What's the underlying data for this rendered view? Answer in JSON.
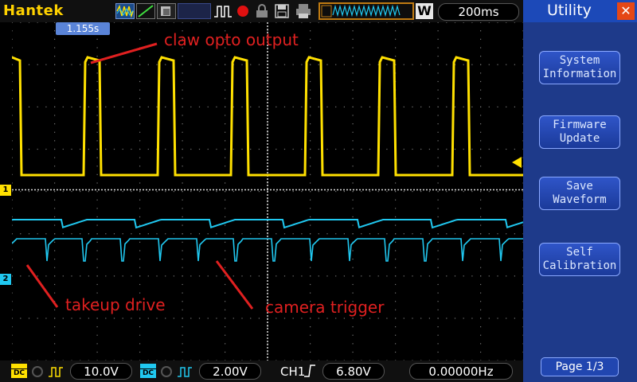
{
  "header": {
    "brand": "Hantek",
    "timebase": "200ms",
    "w_label": "W"
  },
  "cursor_readout": "1.155s",
  "annotations": {
    "claw": "claw opto output",
    "takeup": "takeup drive",
    "camera": "camera trigger"
  },
  "channel_markers": {
    "ch1": "1",
    "ch2": "2"
  },
  "sidebar": {
    "title": "Utility",
    "buttons": [
      {
        "line1": "System",
        "line2": "Information"
      },
      {
        "line1": "Firmware",
        "line2": "Update"
      },
      {
        "line1": "Save",
        "line2": "Waveform"
      },
      {
        "line1": "Self",
        "line2": "Calibration"
      }
    ],
    "page": "Page 1/3"
  },
  "bottom": {
    "ch1_scale": "10.0V",
    "ch2_scale": "2.00V",
    "trigger_source": "CH1",
    "trigger_level": "6.80V",
    "frequency": "0.00000Hz",
    "coupling_dc": "DC"
  },
  "colors": {
    "ch1": "#ffe000",
    "ch2": "#20c8f0",
    "annotation": "#e02020",
    "sidebar": "#1e3a8a"
  }
}
